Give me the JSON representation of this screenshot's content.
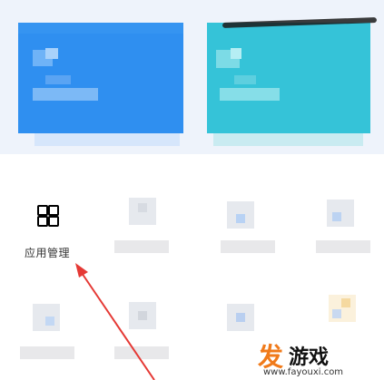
{
  "app_management": {
    "label": "应用管理",
    "icon": "grid-apps-icon"
  },
  "watermark": {
    "brand_first": "发",
    "brand_rest": "游戏",
    "url": "www.fayouxi.com"
  },
  "colors": {
    "card_blue": "#2f8ff0",
    "card_teal": "#35c3d8",
    "arrow": "#e53935",
    "brand_orange": "#f07a1a",
    "icon_accent": "#2b7de9"
  }
}
